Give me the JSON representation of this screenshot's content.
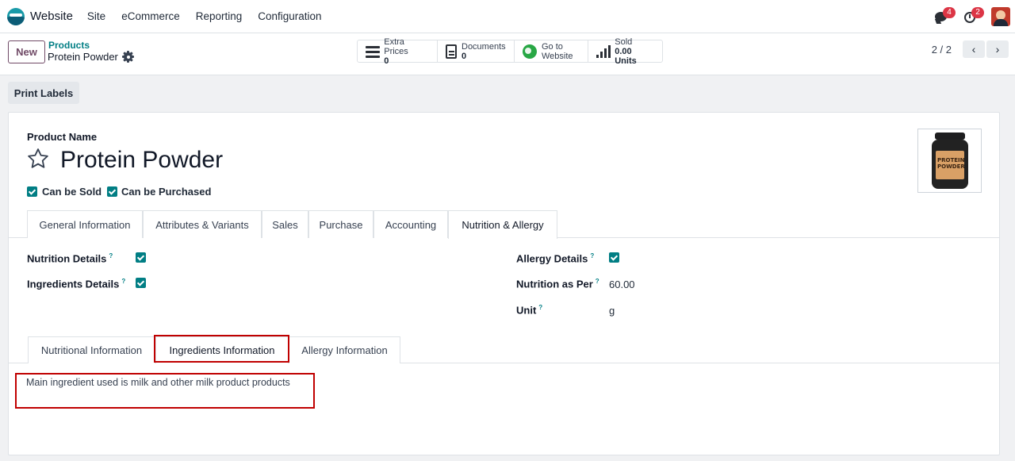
{
  "nav": {
    "app_name": "Website",
    "menu": [
      "Site",
      "eCommerce",
      "Reporting",
      "Configuration"
    ],
    "messages_count": "4",
    "activities_count": "2"
  },
  "control": {
    "new_label": "New",
    "breadcrumb_parent": "Products",
    "record_name": "Protein Powder",
    "smart_buttons": [
      {
        "label": "Extra Prices",
        "value": "0"
      },
      {
        "label": "Documents",
        "value": "0"
      },
      {
        "label": "Go to",
        "value": "Website"
      },
      {
        "label": "Sold",
        "value": "0.00 Units"
      }
    ],
    "pager": "2 / 2"
  },
  "status": {
    "print_labels": "Print Labels"
  },
  "form": {
    "product_name_label": "Product Name",
    "product_name": "Protein Powder",
    "can_be_sold": "Can be Sold",
    "can_be_purchased": "Can be Purchased",
    "image_text": "PROTEIN POWDER",
    "tabs": [
      "General Information",
      "Attributes & Variants",
      "Sales",
      "Purchase",
      "Accounting",
      "Nutrition & Allergy"
    ],
    "active_tab": "Nutrition & Allergy",
    "fields": {
      "nutrition_details": "Nutrition Details",
      "ingredients_details": "Ingredients Details",
      "allergy_details": "Allergy Details",
      "nutrition_as_per": "Nutrition as Per",
      "nutrition_as_per_value": "60.00",
      "unit": "Unit",
      "unit_value": "g",
      "help": "?"
    },
    "subtabs": [
      "Nutritional Information",
      "Ingredients Information",
      "Allergy Information"
    ],
    "active_subtab": "Ingredients Information",
    "ingredients_text": "Main ingredient used is milk and other milk product products"
  },
  "colors": {
    "accent": "#017e84",
    "brand": "#714b67",
    "highlight": "#c00000"
  }
}
